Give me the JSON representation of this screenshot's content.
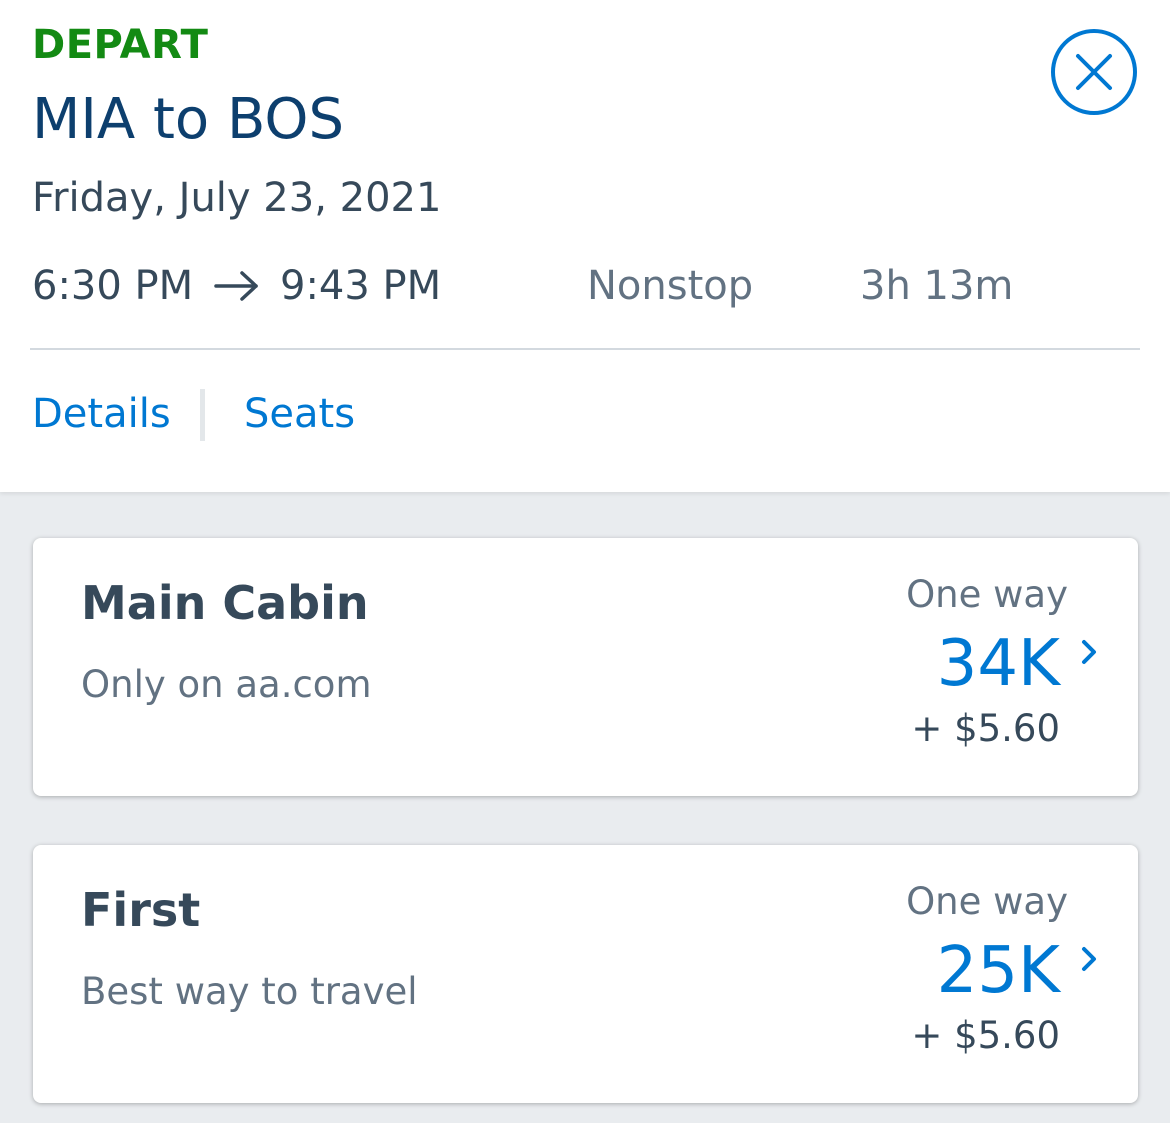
{
  "colors": {
    "depart_green": "#138a13",
    "title_navy": "#0d3f6e",
    "link_blue": "#0078d2",
    "text_dark": "#36495a",
    "text_muted": "#627282",
    "background_gray": "#e9ecef"
  },
  "header": {
    "label": "DEPART",
    "route": "MIA to BOS",
    "date": "Friday, July 23, 2021",
    "depart_time": "6:30 PM",
    "arrow_icon": "arrow-right-icon",
    "arrive_time": "9:43 PM",
    "stops": "Nonstop",
    "duration": "3h 13m",
    "close_icon": "close-circle-icon"
  },
  "links": {
    "details": "Details",
    "seats": "Seats"
  },
  "fares": [
    {
      "name": "Main Cabin",
      "description": "Only on aa.com",
      "trip_type": "One way",
      "miles": "34K",
      "taxes": "+ $5.60",
      "chevron_icon": "chevron-right-icon"
    },
    {
      "name": "First",
      "description": "Best way to travel",
      "trip_type": "One way",
      "miles": "25K",
      "taxes": "+ $5.60",
      "chevron_icon": "chevron-right-icon"
    }
  ]
}
